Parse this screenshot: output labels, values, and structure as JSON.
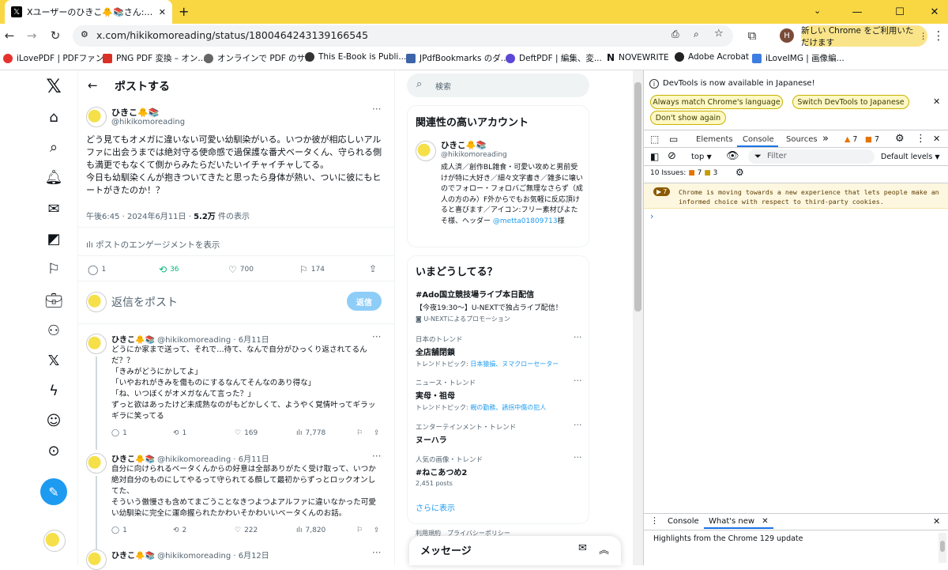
{
  "browser": {
    "tab_title": "Xユーザーのひきこ🐥📚さん:「どう見",
    "url": "x.com/hikikomoreading/status/1800464243139166545",
    "chrome_badge": "新しい Chrome をご利用いただけます",
    "profile_initial": "H",
    "bookmarks": [
      {
        "label": "iLovePDF | PDFファン...",
        "color": "#e5322d"
      },
      {
        "label": "PNG PDF 変換 – オン...",
        "color": "#d93025"
      },
      {
        "label": "オンラインで PDF のサ...",
        "color": "#666666"
      },
      {
        "label": "This E-Book is Publi...",
        "color": "#333333"
      },
      {
        "label": "JPdfBookmarks のダ...",
        "color": "#3c64a8"
      },
      {
        "label": "DeftPDF | 編集、変...",
        "color": "#5a47d6"
      },
      {
        "label": "NOVEWRITE",
        "color": "#111111"
      },
      {
        "label": "Adobe Acrobat",
        "color": "#222222"
      },
      {
        "label": "iLoveIMG | 画像編...",
        "color": "#3d7de2"
      }
    ]
  },
  "header": {
    "back": "←",
    "title": "ポストする"
  },
  "post": {
    "name": "ひきこ🐥📚",
    "handle": "@hikikomoreading",
    "body": "どう見てもオメガに違いない可愛い幼馴染がいる。いつか彼が相応しいアルファに出会うまでは絶対守る使命感で過保護な番犬ベータくん、守られる側も満更でもなくて側からみたらだいたいイチャイチャしてる。\n今日も幼馴染くんが抱きついてきたと思ったら身体が熱い、ついに彼にもヒートがきたのか！？",
    "time": "午後6:45 · 2024年6月11日 · ",
    "views": "5.2万",
    "views_suffix": " 件の表示",
    "engagement": "ポストのエンゲージメントを表示",
    "replies": "1",
    "reposts": "36",
    "likes": "700",
    "bookmarks": "174",
    "reply_placeholder": "返信をポスト",
    "reply_button": "返信"
  },
  "replies": [
    {
      "name": "ひきこ🐥📚",
      "handle_date": "@hikikomoreading · 6月11日",
      "body": "どうにか家まで送って、それで…待て、なんで自分がひっくり返されてるんだ？？\n「きみがどうにかしてよ」\n「いやおれがきみを傷ものにするなんてそんなのあり得な」\n「ね、いつぼくがオメガなんて言った？」\nずっと欲はあったけど未成熟なのがもどかしくて、ようやく覚情叶ってギラッギラに笑ってる",
      "replies": "1",
      "reposts": "1",
      "likes": "169",
      "views": "7,778"
    },
    {
      "name": "ひきこ🐥📚",
      "handle_date": "@hikikomoreading · 6月11日",
      "body": "自分に向けられるベータくんからの好意は全部ありがたく受け取って、いつか絶対自分のものにしてやるって守られてる顔して最初からずっとロックオンしてた、\nそういう傲慢さも含めてまごうことなきつよつよアルファに違いなかった可愛い幼馴染に完全に運命握られたかわいそかわいいベータくんのお話。",
      "replies": "1",
      "reposts": "2",
      "likes": "222",
      "views": "7,820"
    },
    {
      "name": "ひきこ🐥📚",
      "handle_date": "@hikikomoreading · 6月12日"
    }
  ],
  "sidebar": {
    "search_placeholder": "検索",
    "related_title": "関連性の高いアカウント",
    "related_name": "ひきこ🐥📚",
    "related_handle": "@hikikomoreading",
    "related_bio": "成人済／創作BL雑食・可愛い攻めと男前受けが特に大好き／細々文字書き／雑多に壊いのでフォロー・フォロバご無理なさらず（成人の方のみ）F外からでもお気軽に反応頂けると喜びます／アイコン:フリー素材ぴよたそ様、ヘッダー",
    "related_link": "@metta01809713",
    "related_after": "様",
    "trends_title": "いまどうしてる？",
    "promo_name": "#Ado国立競技場ライブ本日配信",
    "promo_desc": "【今夜19:30〜】U-NEXTで独占ライブ配信！",
    "promo_by": "U-NEXTによるプロモーション",
    "trends": [
      {
        "cat": "日本のトレンド",
        "name": "全店舗閉鎖",
        "sub_prefix": "トレンドトピック: ",
        "sub_links": "日本猿損、ヌマクローセーター"
      },
      {
        "cat": "ニュース・トレンド",
        "name": "実母・祖母",
        "sub_prefix": "トレンドトピック: ",
        "sub_links": "親の勤務、誘拐中傷の犯人"
      },
      {
        "cat": "エンターテインメント・トレンド",
        "name": "ヌーハラ",
        "sub_prefix": "",
        "sub_links": ""
      },
      {
        "cat": "人気の画像・トレンド",
        "name": "#ねこあつめ2",
        "sub_prefix": "2,451 posts",
        "sub_links": ""
      }
    ],
    "show_more": "さらに表示",
    "footer": "利用規約　プライバシーポリシー",
    "messages": "メッセージ"
  },
  "devtools": {
    "notice": "DevTools is now available in Japanese!",
    "btn_match": "Always match Chrome's language",
    "btn_switch": "Switch DevTools to Japanese",
    "btn_dont": "Don't show again",
    "tabs": [
      "Elements",
      "Console",
      "Sources"
    ],
    "warn_count": "7",
    "err_count": "7",
    "context": "top",
    "filter": "Filter",
    "levels": "Default levels",
    "issues_label": "10 Issues:",
    "issues_a": "7",
    "issues_b": "3",
    "message": "Chrome is moving towards a new experience that lets people make an informed choice with respect to third-party cookies.",
    "msg_badge": "7",
    "drawer_console": "Console",
    "drawer_whatsnew": "What's new",
    "highlight": "Highlights from the Chrome 129 update"
  }
}
